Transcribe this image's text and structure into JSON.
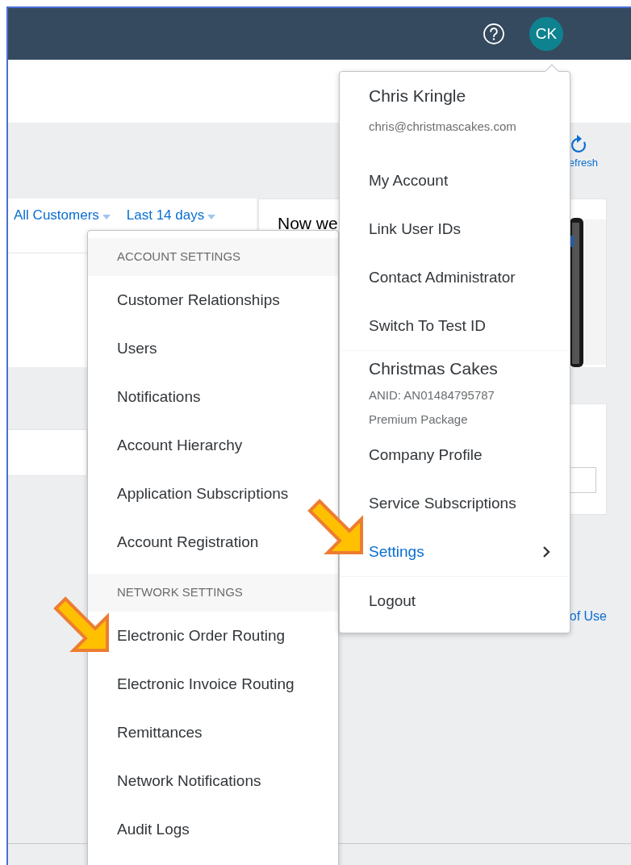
{
  "header": {
    "avatar": {
      "initials": "CK"
    }
  },
  "toolbar": {
    "refresh_label": "efresh"
  },
  "filters": [
    {
      "label": "All Customers"
    },
    {
      "label": "Last 14 days"
    }
  ],
  "promo": {
    "text": "Now we"
  },
  "footer_link": "of Use",
  "profile_menu": {
    "user_name": "Chris Kringle",
    "email": "chris@christmascakes.com",
    "items": [
      {
        "label": "My Account",
        "has_submenu": false,
        "selected": false
      },
      {
        "label": "Link User IDs",
        "has_submenu": false,
        "selected": false
      },
      {
        "label": "Contact Administrator",
        "has_submenu": false,
        "selected": false
      },
      {
        "label": "Switch To Test ID",
        "has_submenu": false,
        "selected": false
      }
    ],
    "company": {
      "name": "Christmas Cakes",
      "anid": "ANID: AN01484795787",
      "package": "Premium Package"
    },
    "company_items": [
      {
        "label": "Company Profile",
        "has_submenu": false,
        "selected": false
      },
      {
        "label": "Service Subscriptions",
        "has_submenu": false,
        "selected": false
      },
      {
        "label": "Settings",
        "has_submenu": true,
        "selected": true
      }
    ],
    "logout": "Logout"
  },
  "settings_menu": {
    "sections": [
      {
        "heading": "ACCOUNT SETTINGS",
        "items": [
          "Customer Relationships",
          "Users",
          "Notifications",
          "Account Hierarchy",
          "Application Subscriptions",
          "Account Registration"
        ]
      },
      {
        "heading": "NETWORK SETTINGS",
        "items": [
          "Electronic Order Routing",
          "Electronic Invoice Routing",
          "Remittances",
          "Network Notifications",
          "Audit Logs"
        ]
      }
    ]
  }
}
